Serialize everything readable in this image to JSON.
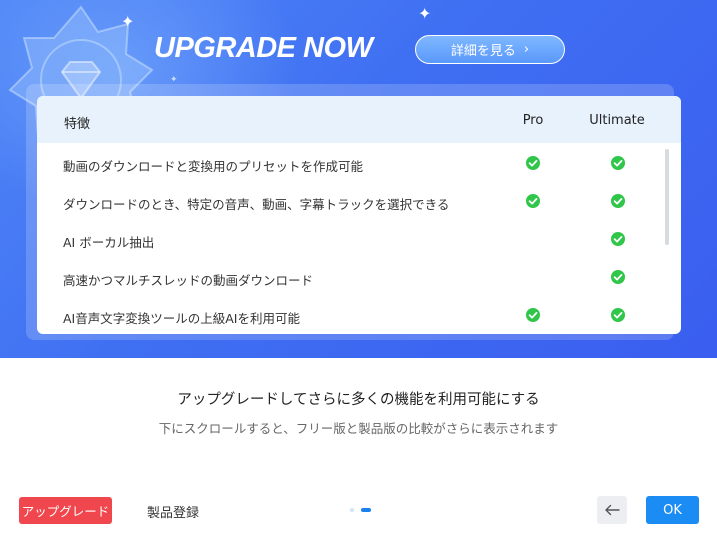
{
  "hero": {
    "title": "UPGRADE NOW",
    "details_label": "詳細を見る",
    "details_chevron": "›"
  },
  "table": {
    "headers": {
      "feature": "特徴",
      "pro": "Pro",
      "ultimate": "Ultimate"
    },
    "rows": [
      {
        "label": "動画のダウンロードと変換用のプリセットを作成可能",
        "pro": true,
        "ultimate": true
      },
      {
        "label": "ダウンロードのとき、特定の音声、動画、字幕トラックを選択できる",
        "pro": true,
        "ultimate": true
      },
      {
        "label": "AI ボーカル抽出",
        "pro": false,
        "ultimate": true
      },
      {
        "label": "高速かつマルチスレッドの動画ダウンロード",
        "pro": false,
        "ultimate": true
      },
      {
        "label": "AI音声文字変換ツールの上級AIを利用可能",
        "pro": true,
        "ultimate": true
      }
    ]
  },
  "promo": {
    "main_text": "アップグレードしてさらに多くの機能を利用可能にする",
    "sub_text": "下にスクロールすると、フリー版と製品版の比較がさらに表示されます"
  },
  "footer": {
    "upgrade_label": "アップグレード",
    "register_label": "製品登録",
    "ok_label": "OK",
    "pager": {
      "pages": 2,
      "current": 2
    }
  },
  "colors": {
    "hero_blue": "#3f6ff2",
    "check_green": "#2fc64a",
    "upgrade_red": "#f0464d",
    "ok_blue": "#1a8cf3"
  },
  "icons": {
    "check": "check-circle-icon",
    "back": "arrow-left-icon",
    "badge": "diamond-badge-icon"
  }
}
